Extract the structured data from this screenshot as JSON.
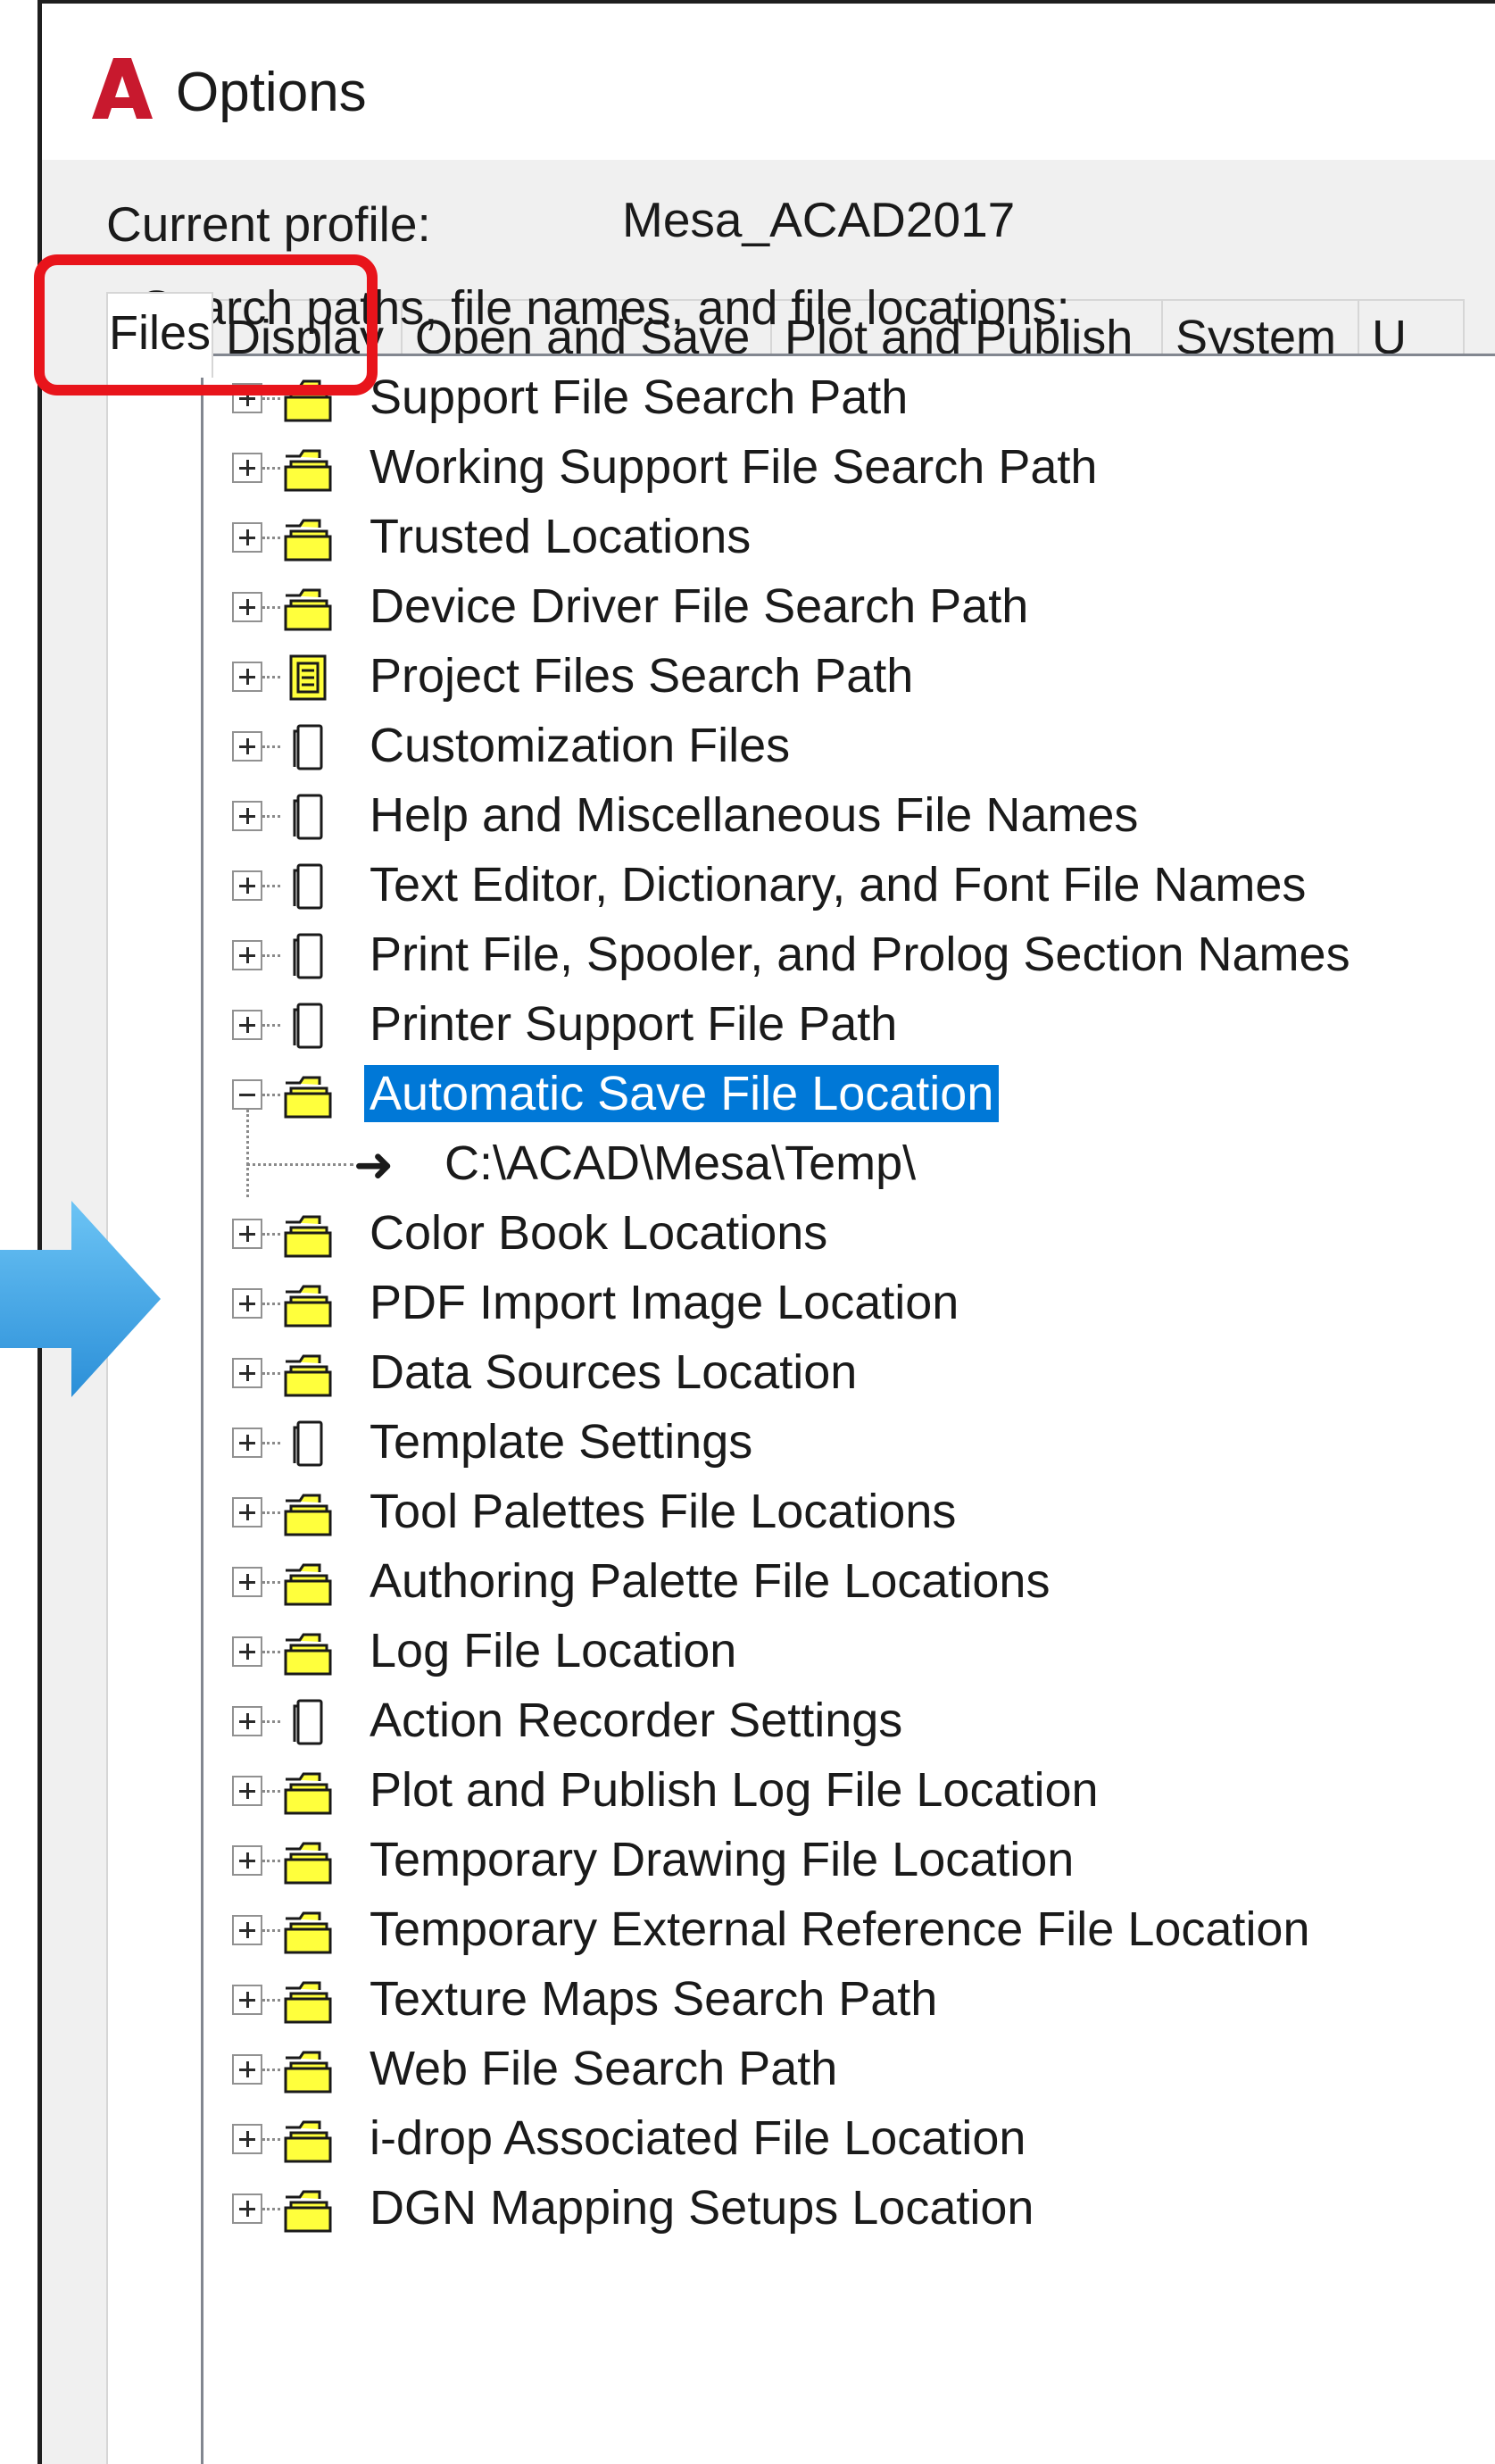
{
  "window": {
    "title": "Options",
    "app_icon": "autocad-logo-icon",
    "app_icon_letter": "A"
  },
  "profile": {
    "label": "Current profile:",
    "value": "Mesa_ACAD2017"
  },
  "tabs": [
    {
      "label": "Files",
      "active": true
    },
    {
      "label": "Display",
      "active": false
    },
    {
      "label": "Open and Save",
      "active": false
    },
    {
      "label": "Plot and Publish",
      "active": false
    },
    {
      "label": "System",
      "active": false
    },
    {
      "label": "U",
      "active": false
    }
  ],
  "files_tab": {
    "search_label": "Search paths, file names, and file locations:",
    "tree": [
      {
        "label": "Support File Search Path",
        "icon": "folder-stack-icon"
      },
      {
        "label": "Working Support File Search Path",
        "icon": "folder-stack-icon"
      },
      {
        "label": "Trusted Locations",
        "icon": "folder-stack-icon"
      },
      {
        "label": "Device Driver File Search Path",
        "icon": "folder-stack-icon"
      },
      {
        "label": "Project Files Search Path",
        "icon": "project-file-icon"
      },
      {
        "label": "Customization Files",
        "icon": "document-icon"
      },
      {
        "label": "Help and Miscellaneous File Names",
        "icon": "document-icon"
      },
      {
        "label": "Text Editor, Dictionary, and Font File Names",
        "icon": "document-icon"
      },
      {
        "label": "Print File, Spooler, and Prolog Section Names",
        "icon": "document-icon"
      },
      {
        "label": "Printer Support File Path",
        "icon": "document-icon"
      },
      {
        "label": "Automatic Save File Location",
        "icon": "folder-stack-icon",
        "expanded": true,
        "selected": true,
        "children": [
          {
            "label": "C:\\ACAD\\Mesa\\Temp\\",
            "icon": "arrow-right-icon"
          }
        ]
      },
      {
        "label": "Color Book Locations",
        "icon": "folder-stack-icon"
      },
      {
        "label": "PDF Import Image Location",
        "icon": "folder-stack-icon"
      },
      {
        "label": "Data Sources Location",
        "icon": "folder-stack-icon"
      },
      {
        "label": "Template Settings",
        "icon": "document-icon"
      },
      {
        "label": "Tool Palettes File Locations",
        "icon": "folder-stack-icon"
      },
      {
        "label": "Authoring Palette File Locations",
        "icon": "folder-stack-icon"
      },
      {
        "label": "Log File Location",
        "icon": "folder-stack-icon"
      },
      {
        "label": "Action Recorder Settings",
        "icon": "document-icon"
      },
      {
        "label": "Plot and Publish Log File Location",
        "icon": "folder-stack-icon"
      },
      {
        "label": "Temporary Drawing File Location",
        "icon": "folder-stack-icon"
      },
      {
        "label": "Temporary External Reference File Location",
        "icon": "folder-stack-icon"
      },
      {
        "label": "Texture Maps Search Path",
        "icon": "folder-stack-icon"
      },
      {
        "label": "Web File Search Path",
        "icon": "folder-stack-icon"
      },
      {
        "label": "i-drop Associated File Location",
        "icon": "folder-stack-icon"
      },
      {
        "label": "DGN Mapping Setups Location",
        "icon": "folder-stack-icon"
      }
    ]
  },
  "annotations": {
    "highlight_color": "#e8141b",
    "pointer_arrow_color": "#3aa0e8",
    "selection_color": "#0078d7"
  }
}
